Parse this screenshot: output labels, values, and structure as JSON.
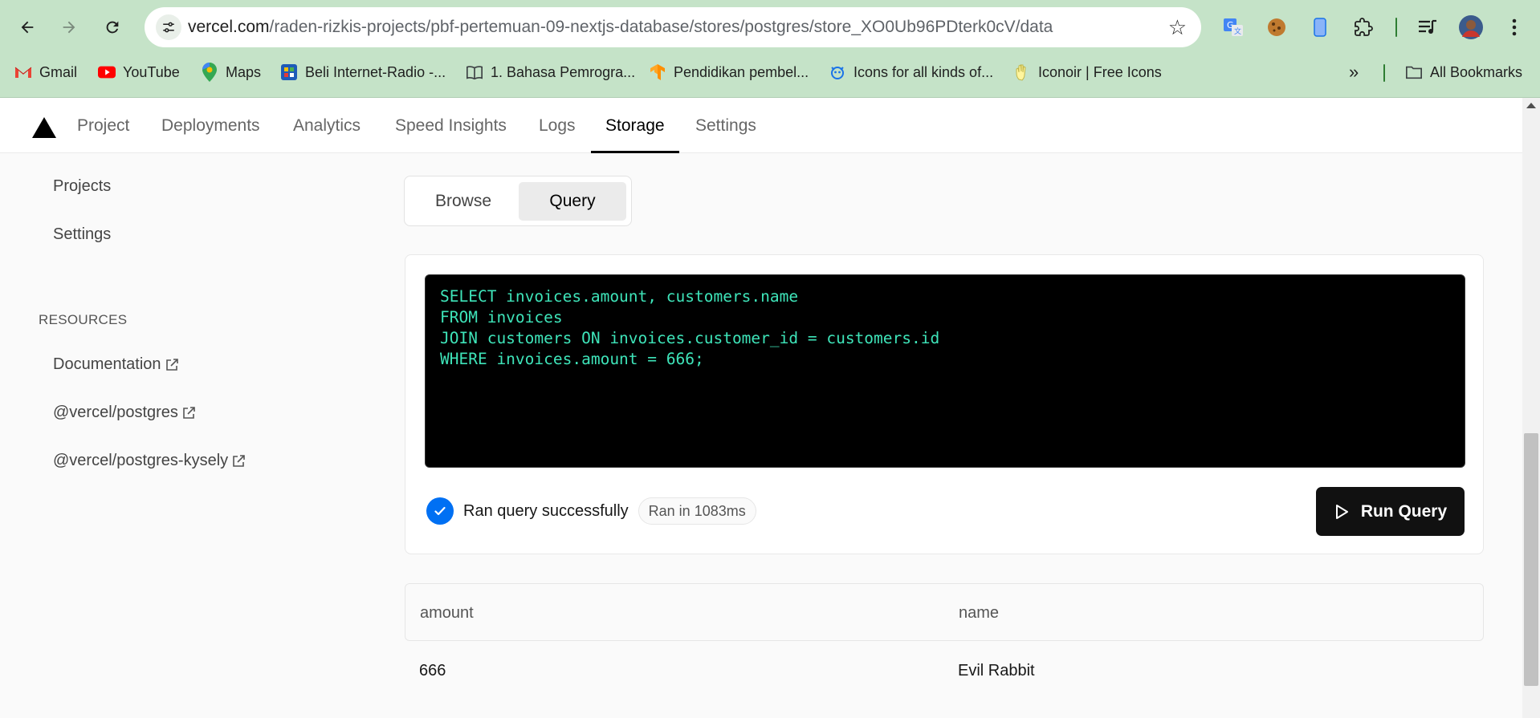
{
  "browser": {
    "url_host": "vercel.com",
    "url_path": "/raden-rizkis-projects/pbf-pertemuan-09-nextjs-database/stores/postgres/store_XO0Ub96PDterk0cV/data",
    "bookmarks": [
      {
        "label": "Gmail",
        "icon": "gmail-icon"
      },
      {
        "label": "YouTube",
        "icon": "youtube-icon"
      },
      {
        "label": "Maps",
        "icon": "maps-icon"
      },
      {
        "label": "Beli Internet-Radio -...",
        "icon": "radio-icon"
      },
      {
        "label": "1. Bahasa Pemrogra...",
        "icon": "book-icon"
      },
      {
        "label": "Pendidikan pembel...",
        "icon": "tensorflow-icon"
      },
      {
        "label": "Icons for all kinds of...",
        "icon": "icons-icon"
      },
      {
        "label": "Iconoir | Free Icons",
        "icon": "iconoir-icon"
      }
    ],
    "all_bookmarks": "All Bookmarks"
  },
  "topnav": {
    "tabs": [
      "Project",
      "Deployments",
      "Analytics",
      "Speed Insights",
      "Logs",
      "Storage",
      "Settings"
    ],
    "active": "Storage"
  },
  "sidebar": {
    "items": [
      "Projects",
      "Settings"
    ],
    "resources_heading": "RESOURCES",
    "resources": [
      "Documentation",
      "@vercel/postgres",
      "@vercel/postgres-kysely"
    ]
  },
  "toggle": {
    "browse": "Browse",
    "query": "Query",
    "selected": "Query"
  },
  "query": {
    "sql": "SELECT invoices.amount, customers.name\nFROM invoices\nJOIN customers ON invoices.customer_id = customers.id\nWHERE invoices.amount = 666;",
    "status_message": "Ran query successfully",
    "duration": "Ran in 1083ms",
    "run_label": "Run Query"
  },
  "results": {
    "columns": [
      "amount",
      "name"
    ],
    "rows": [
      [
        "666",
        "Evil Rabbit"
      ]
    ]
  },
  "colors": {
    "accent": "#0070f3",
    "code_text": "#3ee4b9",
    "chrome_bg": "#c5e3c8"
  }
}
